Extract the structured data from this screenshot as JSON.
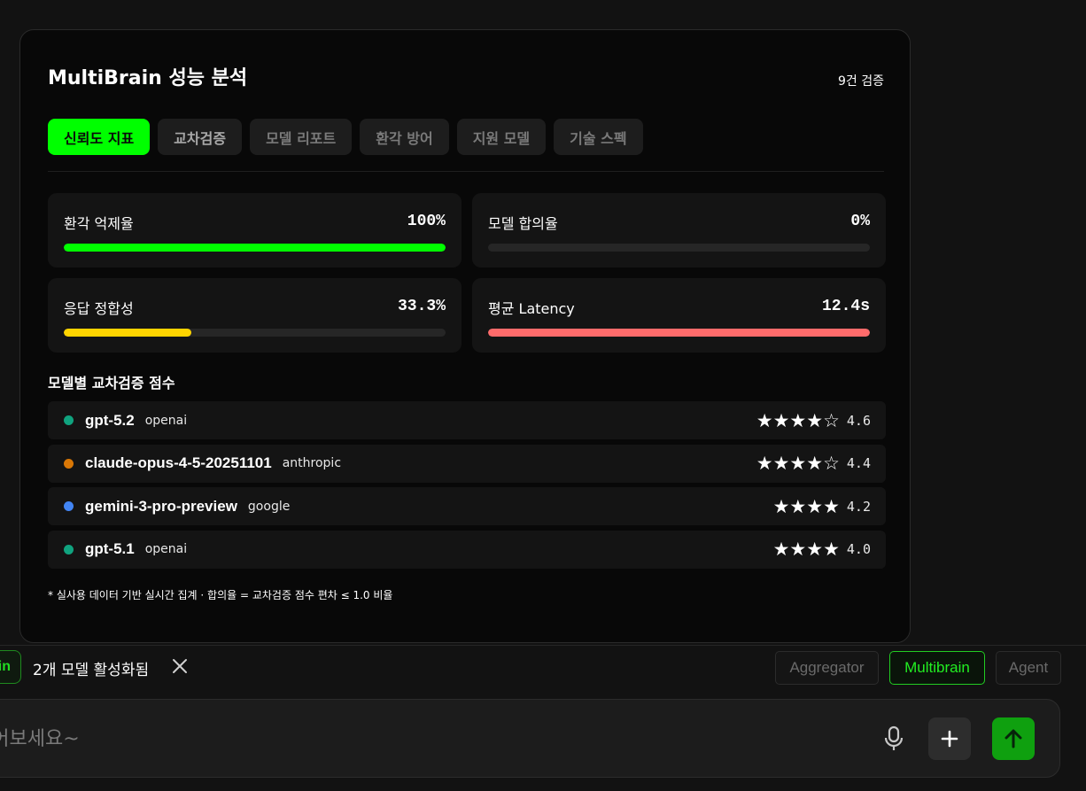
{
  "panel": {
    "title": "MultiBrain 성능 분석",
    "count_label": "9건 검증",
    "tabs": [
      {
        "label": "신뢰도 지표",
        "active": true
      },
      {
        "label": "교차검증",
        "active": false
      },
      {
        "label": "모델 리포트",
        "active": false
      },
      {
        "label": "환각 방어",
        "active": false
      },
      {
        "label": "지원 모델",
        "active": false
      },
      {
        "label": "기술 스펙",
        "active": false
      }
    ],
    "metrics": [
      {
        "label": "환각 억제율",
        "value": "100%",
        "level": 1.0,
        "color": "#00ff00"
      },
      {
        "label": "모델 합의율",
        "value": "0%",
        "level": 0.0,
        "color": "#00ff00"
      },
      {
        "label": "응답 정합성",
        "value": "33.3%",
        "level": 0.333,
        "color": "#ffd400"
      },
      {
        "label": "평균 Latency",
        "value": "12.4s",
        "level": 1.0,
        "color": "#ff6b6b"
      }
    ],
    "models_title": "모델별 교차검증 점수",
    "models": [
      {
        "name": "gpt-5.2",
        "vendor": "openai",
        "stars": "★★★★☆",
        "score": "4.6",
        "dot_color": "#10a37f"
      },
      {
        "name": "claude-opus-4-5-20251101",
        "vendor": "anthropic",
        "stars": "★★★★☆",
        "score": "4.4",
        "dot_color": "#d97706"
      },
      {
        "name": "gemini-3-pro-preview",
        "vendor": "google",
        "stars": "★★★★",
        "score": "4.2",
        "dot_color": "#4285f4"
      },
      {
        "name": "gpt-5.1",
        "vendor": "openai",
        "stars": "★★★★",
        "score": "4.0",
        "dot_color": "#10a37f"
      }
    ],
    "footnote": "* 실사용 데이터 기반 실시간 집계 · 합의율 = 교차검증 점수 편차 ≤ 1.0 비율"
  },
  "bottom_bar": {
    "brain_chip_label": "in",
    "active_models_text": "2개 모델 활성화됨",
    "modes": [
      {
        "label": "Aggregator",
        "active": false
      },
      {
        "label": "Multibrain",
        "active": true
      },
      {
        "label": "Agent",
        "active": false
      }
    ]
  },
  "chat": {
    "placeholder": "물어보세요~"
  },
  "icons": {
    "close": "close-icon",
    "mic": "microphone-icon",
    "plus": "plus-icon",
    "send": "arrow-up-icon"
  }
}
